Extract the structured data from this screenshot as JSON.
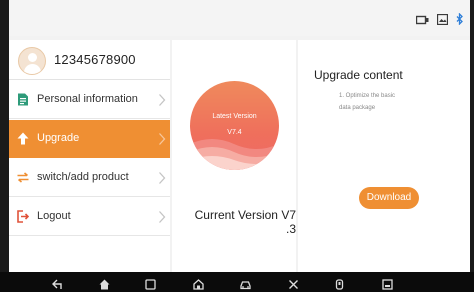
{
  "profile": {
    "id": "12345678900"
  },
  "menu": {
    "items": [
      {
        "label": "Personal information"
      },
      {
        "label": "Upgrade"
      },
      {
        "label": "switch/add product"
      },
      {
        "label": "Logout"
      }
    ]
  },
  "version": {
    "latest_label": "Latest Version",
    "latest_value": "V7.4",
    "current_line1": "Current Version V7",
    "current_line2": ".3"
  },
  "upgrade": {
    "title": "Upgrade content",
    "notes_line1": "1. Optimize the basic",
    "notes_line2": "data package",
    "download_label": "Download"
  },
  "colors": {
    "accent": "#ef8f33",
    "version_circle": "#ef6f5c",
    "status_icons": "#3a3a3a",
    "bluetooth_icon": "#2f7fd8"
  },
  "icons": {
    "status": [
      "vci-connection-icon",
      "gallery-icon",
      "bluetooth-icon"
    ],
    "menu": [
      "document-icon",
      "upload-arrow-icon",
      "swap-arrows-icon",
      "logout-icon"
    ],
    "nav": [
      "back-icon",
      "home-icon",
      "recent-apps-icon",
      "home-alt-icon",
      "vehicle-icon",
      "tools-icon",
      "vci-icon",
      "screenshot-icon"
    ]
  }
}
